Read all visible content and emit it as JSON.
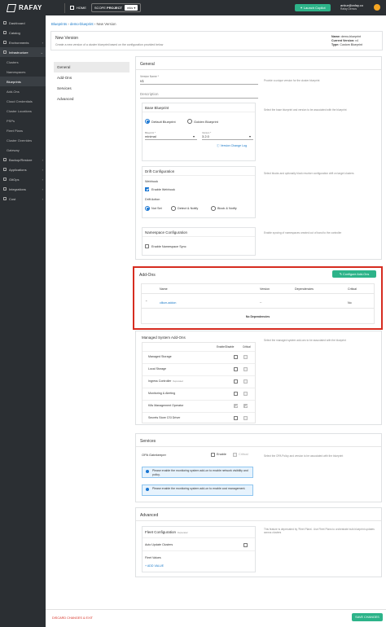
{
  "topbar": {
    "brand": "RAFAY",
    "home": "HOME",
    "scope_label": "SCOPE",
    "scope_type": "PROJECT",
    "project": "mks",
    "launch_copilot": "Launch Copilot",
    "user_email": "ankur@rafay.co",
    "user_org": "Rafay Demos"
  },
  "sidebar": {
    "items": [
      {
        "label": "Dashboard"
      },
      {
        "label": "Catalog"
      },
      {
        "label": "Environments"
      },
      {
        "label": "Infrastructure"
      },
      {
        "label": "Clusters"
      },
      {
        "label": "Namespaces"
      },
      {
        "label": "Blueprints"
      },
      {
        "label": "Add-Ons"
      },
      {
        "label": "Cloud Credentials"
      },
      {
        "label": "Cluster Locations"
      },
      {
        "label": "PSPs"
      },
      {
        "label": "Fleet Plans"
      },
      {
        "label": "Cluster Overrides"
      },
      {
        "label": "Gateway"
      },
      {
        "label": "Backup/Restore"
      },
      {
        "label": "Applications"
      },
      {
        "label": "GitOps"
      },
      {
        "label": "Integrations"
      },
      {
        "label": "Cost"
      }
    ]
  },
  "breadcrumb": {
    "root": "Blueprints",
    "parent": "demo-blueprint",
    "current": "New Version"
  },
  "header": {
    "title": "New Version",
    "description": "Create a new version of a cluster blueprint based on the configuration provided below",
    "meta_name_label": "Name:",
    "meta_name": "demo-blueprint",
    "meta_version_label": "Current Version:",
    "meta_version": "v4",
    "meta_type_label": "Type:",
    "meta_type": "Custom Blueprint"
  },
  "nav": [
    "General",
    "Add-Ons",
    "Services",
    "Advanced"
  ],
  "general": {
    "title": "General",
    "version_label": "Version Name *",
    "version_value": "v1",
    "version_help": "Provide a unique version for the cluster blueprint",
    "description_placeholder": "Description",
    "base_title": "Base Blueprint",
    "base_help": "Select the base blueprint and version to be associated with the blueprint",
    "opt_default": "Default Blueprint",
    "opt_golden": "Golden Blueprint",
    "blueprint_label": "Blueprint *",
    "blueprint_value": "minimal",
    "version_sel_label": "Version *",
    "version_sel_value": "3.2.0",
    "version_change_log": "Version Change Log",
    "drift_title": "Drift Configuration",
    "drift_help": "Select blocks and optionally block resolver configuration drift on target clusters",
    "webhook": "Webhook",
    "enable_webhook": "Enable Webhook",
    "drift_action": "Drift Action",
    "opt_notset": "Not Set",
    "opt_detect": "Detect & Notify",
    "opt_block": "Block & Notify",
    "ns_title": "Namespace Configuration",
    "ns_help": "Enable syncing of namespaces created out of band to the controller",
    "ns_sync": "Enable Namespace Sync"
  },
  "addons": {
    "title": "Add-Ons",
    "configure": "Configure Add-Ons",
    "columns": [
      "Name",
      "Version",
      "Dependencies",
      "Critical"
    ],
    "rows": [
      {
        "name": "cilium-addon",
        "version": "--",
        "critical": "No"
      }
    ],
    "no_deps": "No Dependencies"
  },
  "managed": {
    "title": "Managed System Add-Ons",
    "help": "Select the managed system add-ons to be associated with the blueprint",
    "col_enable": "Enable/Disable",
    "col_critical": "Critical",
    "items": [
      {
        "name": "Managed Storage",
        "badge": ""
      },
      {
        "name": "Local Storage",
        "badge": ""
      },
      {
        "name": "Ingress Controller",
        "badge": "Deprecated"
      },
      {
        "name": "Monitoring & Alerting",
        "badge": ""
      },
      {
        "name": "K8s Management Operator",
        "badge": ""
      },
      {
        "name": "Secrets Store CSI Driver",
        "badge": ""
      }
    ]
  },
  "services": {
    "title": "Services",
    "opa": "OPA Gatekeeper",
    "enable": "Enable",
    "critical": "Critical",
    "help": "Select the OPA Policy and version to be associated with the blueprint",
    "alert1": "Please enable the monitoring system add-on to enable network visibility and policy.",
    "alert2": "Please enable the monitoring system add-on to enable cost management."
  },
  "advanced": {
    "title": "Advanced",
    "fleet": "Fleet Configuration",
    "fleet_badge": "Deprecated",
    "auto_update": "Auto Update Clusters",
    "fleet_values": "Fleet Values",
    "add_value": "+ ADD VALUE",
    "help": "This feature is deprecated by 'Fleet Plans'. Use Fleet Plans to orchestrate bulk blueprint updates across clusters"
  },
  "footer": {
    "discard": "DISCARD CHANGES & EXIT",
    "save": "SAVE CHANGES"
  },
  "colors": {
    "accent": "#1976d2",
    "primary_green": "#2db389",
    "highlight_red": "#d62c20",
    "nav_bg": "#2b2f33"
  }
}
